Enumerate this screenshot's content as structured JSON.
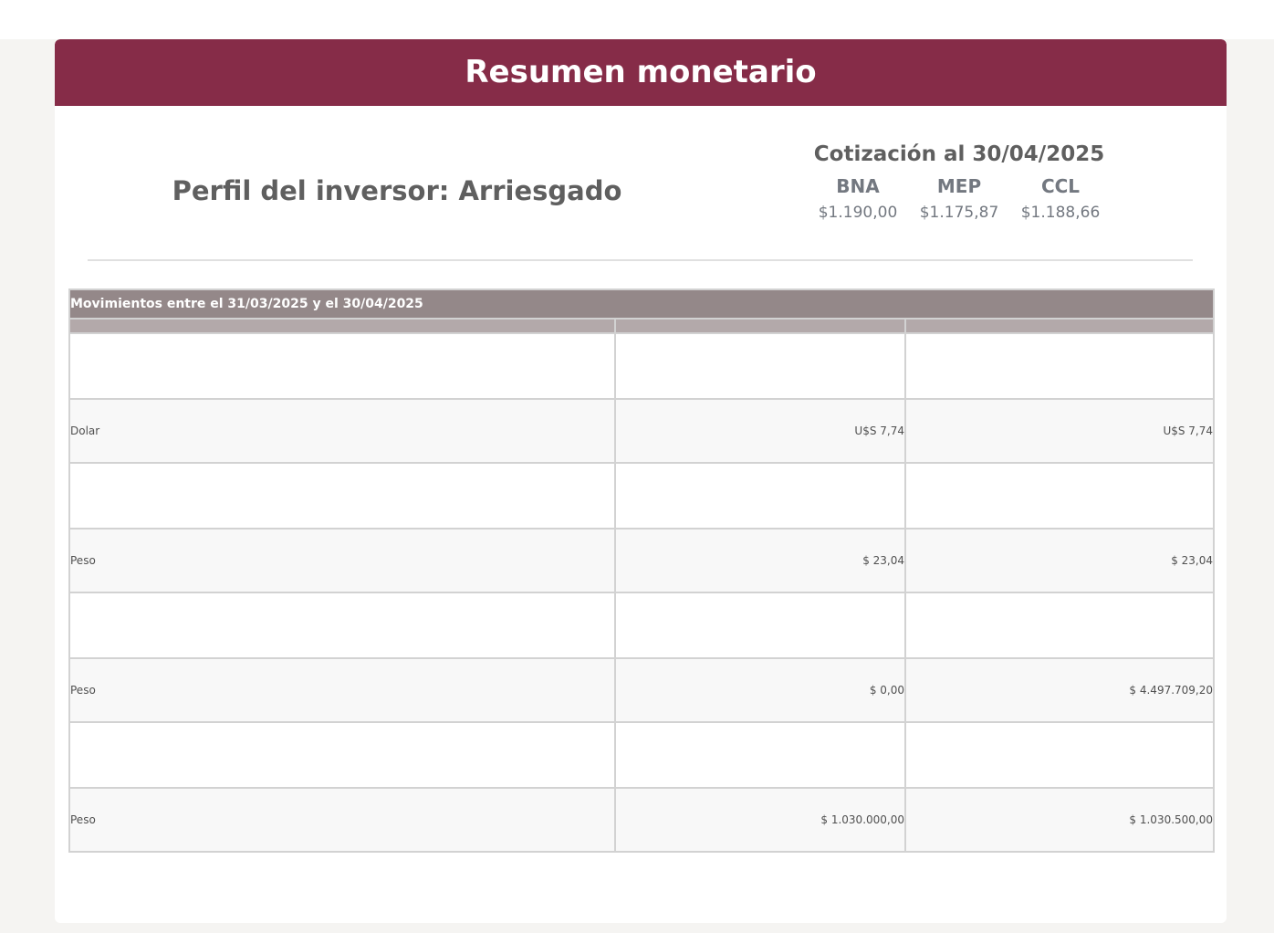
{
  "header": {
    "title": "Resumen monetario"
  },
  "perfil": {
    "text": "Perfil del inversor: Arriesgado"
  },
  "cotizacion": {
    "title": "Cotización al 30/04/2025",
    "rates": [
      {
        "label": "BNA",
        "value": "$1.190,00"
      },
      {
        "label": "MEP",
        "value": "$1.175,87"
      },
      {
        "label": "CCL",
        "value": "$1.188,66"
      }
    ]
  },
  "movimientos": {
    "caption": "Movimientos entre el 31/03/2025 y el 30/04/2025",
    "rows": [
      {
        "currency": "Dolar",
        "col2": "U$S 7,74",
        "col3": "U$S 7,74"
      },
      {
        "currency": "Peso",
        "col2": "$ 23,04",
        "col3": "$ 23,04"
      },
      {
        "currency": "Peso",
        "col2": "$ 0,00",
        "col3": "$ 4.497.709,20"
      },
      {
        "currency": "Peso",
        "col2": "$ 1.030.000,00",
        "col3": "$ 1.030.500,00"
      }
    ]
  },
  "colors": {
    "header_bg": "#862c48",
    "table_caption_bg": "#948889",
    "table_head_bg": "#b3a9aa"
  }
}
